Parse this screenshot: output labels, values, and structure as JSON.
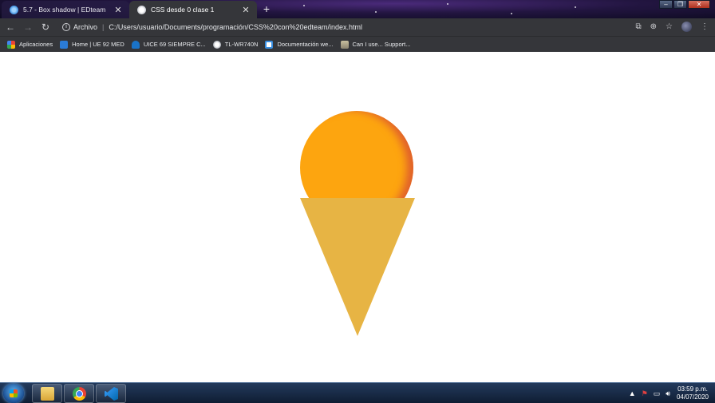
{
  "browser": {
    "tabs": [
      {
        "title": "5.7 - Box shadow | EDteam",
        "active": false
      },
      {
        "title": "CSS desde 0 clase 1",
        "active": true
      }
    ],
    "new_tab_label": "+",
    "window_buttons": [
      "–",
      "❐",
      "✕"
    ],
    "address": {
      "scheme_label": "Archivo",
      "url": "C:/Users/usuario/Documents/programación/CSS%20con%20edteam/index.html"
    },
    "bookmarks": [
      {
        "label": "Aplicaciones",
        "icon": "apps-grid-icon"
      },
      {
        "label": "Home | UE 92 MED",
        "icon": "moodle-icon"
      },
      {
        "label": "UICE 69 SIEMPRE C...",
        "icon": "cloud-icon"
      },
      {
        "label": "TL-WR740N",
        "icon": "globe-icon"
      },
      {
        "label": "Documentación we...",
        "icon": "mdn-icon"
      },
      {
        "label": "Can I use... Support...",
        "icon": "caniuse-icon"
      }
    ]
  },
  "content": {
    "scoop_color": "#fda50f",
    "scoop_shadow_color": "#e0602c",
    "cone_color": "#e7b444"
  },
  "taskbar": {
    "time": "03:59 p.m.",
    "date": "04/07/2020",
    "apps": [
      "file-explorer-icon",
      "chrome-icon",
      "vscode-icon"
    ]
  }
}
